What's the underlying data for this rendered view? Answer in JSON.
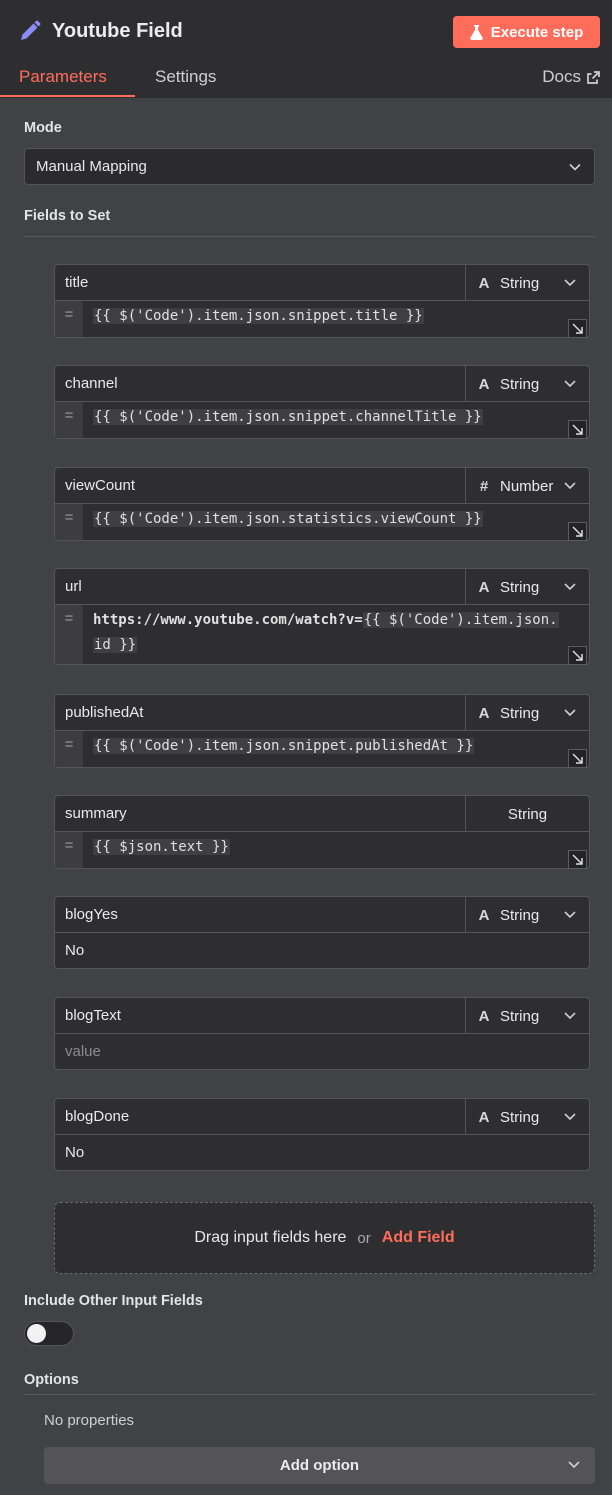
{
  "header": {
    "node_title": "Youtube Field",
    "execute_label": "Execute step",
    "accent": "#ff6d5a",
    "tabs": [
      {
        "label": "Parameters",
        "active": true
      },
      {
        "label": "Settings",
        "active": false
      }
    ],
    "docs_label": "Docs"
  },
  "mode": {
    "label": "Mode",
    "value": "Manual Mapping"
  },
  "fields_section": {
    "label": "Fields to Set",
    "fields": [
      {
        "name": "title",
        "type": "String",
        "type_icon": "A",
        "value_kind": "expression",
        "value_prefix": "",
        "value_expr": "{{ $('Code').item.json.snippet.title }}",
        "value_expr2": ""
      },
      {
        "name": "channel",
        "type": "String",
        "type_icon": "A",
        "value_kind": "expression",
        "value_prefix": "",
        "value_expr": "{{ $('Code').item.json.snippet.channelTitle }}",
        "value_expr2": ""
      },
      {
        "name": "viewCount",
        "type": "Number",
        "type_icon": "#",
        "value_kind": "expression",
        "value_prefix": "",
        "value_expr": "{{ $('Code').item.json.statistics.viewCount }}",
        "value_expr2": ""
      },
      {
        "name": "url",
        "type": "String",
        "type_icon": "A",
        "value_kind": "expression",
        "value_prefix": "https://www.youtube.com/watch?v=",
        "value_expr": "{{ $('Code').item.json.",
        "value_expr2": "id }}"
      },
      {
        "name": "publishedAt",
        "type": "String",
        "type_icon": "A",
        "value_kind": "expression",
        "value_prefix": "",
        "value_expr": "{{ $('Code').item.json.snippet.publishedAt }}",
        "value_expr2": ""
      },
      {
        "name": "summary",
        "type": "String",
        "type_icon": "",
        "value_kind": "expression",
        "value_prefix": "",
        "value_expr": "{{ $json.text }}",
        "value_expr2": ""
      },
      {
        "name": "blogYes",
        "type": "String",
        "type_icon": "A",
        "value_kind": "fixed",
        "value": "No"
      },
      {
        "name": "blogText",
        "type": "String",
        "type_icon": "A",
        "value_kind": "placeholder",
        "placeholder": "value"
      },
      {
        "name": "blogDone",
        "type": "String",
        "type_icon": "A",
        "value_kind": "fixed",
        "value": "No"
      }
    ]
  },
  "dropzone": {
    "drag_text": "Drag input fields here",
    "or_text": "or",
    "add_field_label": "Add Field"
  },
  "include_other": {
    "label": "Include Other Input Fields",
    "enabled": false
  },
  "options": {
    "label": "Options",
    "empty_text": "No properties",
    "add_option_label": "Add option"
  }
}
